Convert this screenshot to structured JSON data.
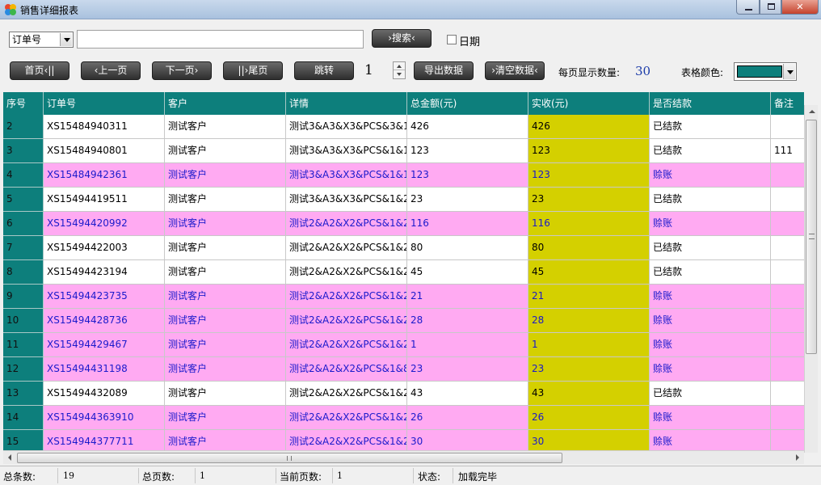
{
  "window": {
    "title": "销售详细报表",
    "minimize_label": "─",
    "maximize_label": "□",
    "close_label": "✕"
  },
  "search": {
    "field_selected": "订单号",
    "input_value": "",
    "search_button": "›搜索‹",
    "date_checkbox_label": "日期",
    "date_checked": false
  },
  "toolbar": {
    "first_page": "首页‹||",
    "prev_page": "‹上一页",
    "next_page": "下一页›",
    "last_page": "||›尾页",
    "jump": "跳转",
    "page_number": "1",
    "export": "导出数据",
    "clear": "›清空数据‹",
    "page_size_label": "每页显示数量:",
    "page_size_value": "30",
    "table_color_label": "表格颜色:",
    "table_color": "#0d7f7c"
  },
  "colors": {
    "header": "#0d7f7c",
    "paid_column": "#d4d000",
    "debt_row": "#ffaaf2",
    "debt_text": "#1a1acc"
  },
  "table": {
    "columns": [
      "序号",
      "订单号",
      "客户",
      "详情",
      "总金额(元)",
      "实收(元)",
      "是否结款",
      "备注"
    ],
    "rows": [
      [
        "2",
        "XS15484940311",
        "测试客户",
        "测试3&A3&X3&PCS&3&1",
        "426",
        "426",
        "已结款",
        ""
      ],
      [
        "3",
        "XS15484940801",
        "测试客户",
        "测试3&A3&X3&PCS&1&1",
        "123",
        "123",
        "已结款",
        "111"
      ],
      [
        "4",
        "XS15484942361",
        "测试客户",
        "测试3&A3&X3&PCS&1&1",
        "123",
        "123",
        "赊账",
        ""
      ],
      [
        "5",
        "XS15494419511",
        "测试客户",
        "测试3&A3&X3&PCS&1&2",
        "23",
        "23",
        "已结款",
        ""
      ],
      [
        "6",
        "XS15494420992",
        "测试客户",
        "测试2&A2&X2&PCS&1&2",
        "116",
        "116",
        "赊账",
        ""
      ],
      [
        "7",
        "XS15494422003",
        "测试客户",
        "测试2&A2&X2&PCS&1&2",
        "80",
        "80",
        "已结款",
        ""
      ],
      [
        "8",
        "XS15494423194",
        "测试客户",
        "测试2&A2&X2&PCS&1&2",
        "45",
        "45",
        "已结款",
        ""
      ],
      [
        "9",
        "XS15494423735",
        "测试客户",
        "测试2&A2&X2&PCS&1&2",
        "21",
        "21",
        "赊账",
        ""
      ],
      [
        "10",
        "XS15494428736",
        "测试客户",
        "测试2&A2&X2&PCS&1&2",
        "28",
        "28",
        "赊账",
        ""
      ],
      [
        "11",
        "XS15494429467",
        "测试客户",
        "测试2&A2&X2&PCS&1&2",
        "1",
        "1",
        "赊账",
        ""
      ],
      [
        "12",
        "XS15494431198",
        "测试客户",
        "测试2&A2&X2&PCS&1&8",
        "23",
        "23",
        "赊账",
        ""
      ],
      [
        "13",
        "XS15494432089",
        "测试客户",
        "测试2&A2&X2&PCS&1&2",
        "43",
        "43",
        "已结款",
        ""
      ],
      [
        "14",
        "XS154944363910",
        "测试客户",
        "测试2&A2&X2&PCS&1&2",
        "26",
        "26",
        "赊账",
        ""
      ],
      [
        "15",
        "XS154944377711",
        "测试客户",
        "测试2&A2&X2&PCS&1&2",
        "30",
        "30",
        "赊账",
        ""
      ]
    ]
  },
  "status": {
    "total_count_label": "总条数:",
    "total_count": "19",
    "total_pages_label": "总页数:",
    "total_pages": "1",
    "current_page_label": "当前页数:",
    "current_page": "1",
    "state_label": "状态:",
    "state_value": "加载完毕"
  }
}
